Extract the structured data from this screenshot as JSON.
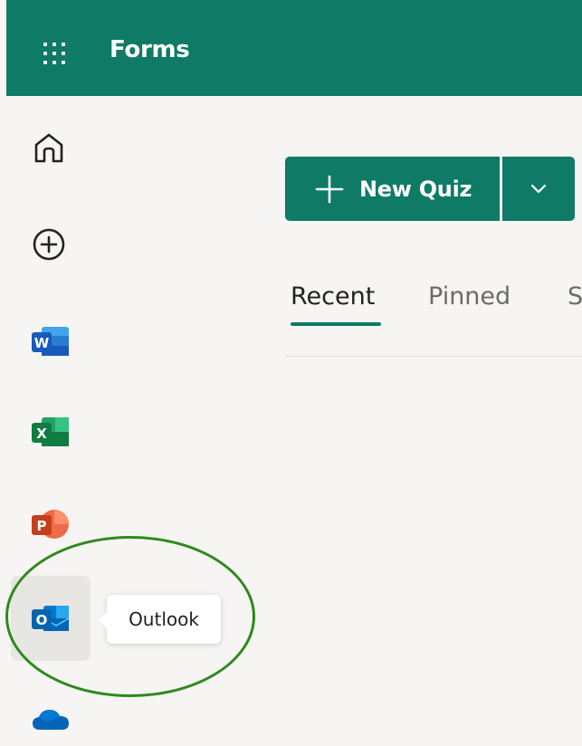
{
  "header": {
    "app_title": "Forms",
    "app_launcher_icon": "waffle-icon",
    "color": "#0f7a66"
  },
  "rail": {
    "items": [
      {
        "name": "Home",
        "icon": "home-icon"
      },
      {
        "name": "Create",
        "icon": "plus-circle-icon"
      },
      {
        "name": "Word",
        "icon": "word-icon",
        "color": "#185abd"
      },
      {
        "name": "Excel",
        "icon": "excel-icon",
        "color": "#107c41"
      },
      {
        "name": "PowerPoint",
        "icon": "powerpoint-icon",
        "color": "#c43e1c"
      },
      {
        "name": "Outlook",
        "icon": "outlook-icon",
        "color": "#0a64ad"
      },
      {
        "name": "OneDrive",
        "icon": "onedrive-icon",
        "color": "#0364b8"
      }
    ],
    "hovered_item": "Outlook"
  },
  "tooltip": {
    "text": "Outlook"
  },
  "toolbar": {
    "new_quiz_label": "New Quiz",
    "new_quiz_icon": "plus-icon",
    "dropdown_icon": "chevron-down-icon"
  },
  "tabs": [
    {
      "label": "Recent",
      "selected": true
    },
    {
      "label": "Pinned",
      "selected": false
    },
    {
      "label": "S",
      "selected": false
    }
  ],
  "annotation": {
    "shape": "ellipse",
    "color": "#2d8a1c"
  }
}
